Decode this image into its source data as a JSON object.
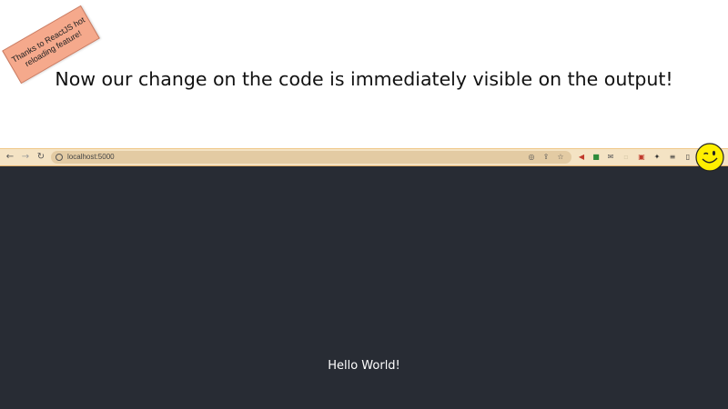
{
  "note": {
    "line1": "Thanks to ReactJS hot",
    "line2": "reloading feature!"
  },
  "headline": "Now our change on the code is immediately visible on the output!",
  "browser": {
    "url": "localhost:5000",
    "nav": {
      "back_icon": "arrow-left-icon",
      "forward_icon": "arrow-right-icon",
      "reload_icon": "reload-icon"
    },
    "toolbar_color": "#f4e3c4",
    "content_background": "#282c34"
  },
  "page": {
    "text": "Hello World!",
    "text_color": "#ffffff"
  },
  "colors": {
    "note_fill": "#f5a98c",
    "smiley_fill": "#ffef00"
  }
}
